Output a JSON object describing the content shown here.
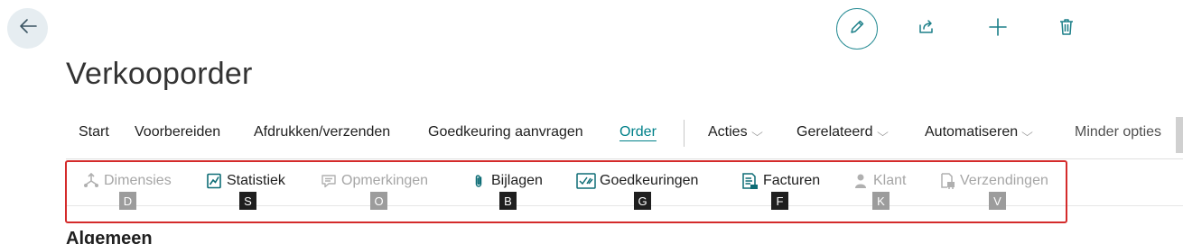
{
  "page": {
    "title": "Verkooporder"
  },
  "actions": {
    "back": "arrow-left-icon",
    "edit": "pencil-icon",
    "share": "share-icon",
    "add": "plus-icon",
    "delete": "trash-icon"
  },
  "menu": {
    "items": [
      {
        "label": "Start"
      },
      {
        "label": "Voorbereiden"
      },
      {
        "label": "Afdrukken/verzenden"
      },
      {
        "label": "Goedkeuring aanvragen"
      },
      {
        "label": "Order",
        "active": true
      },
      {
        "label": "Acties",
        "dropdown": true
      },
      {
        "label": "Gerelateerd",
        "dropdown": true
      },
      {
        "label": "Automatiseren",
        "dropdown": true
      },
      {
        "label": "Minder opties"
      }
    ]
  },
  "subactions": [
    {
      "label": "Dimensies",
      "key": "D",
      "enabled": false,
      "icon": "dimensions-icon"
    },
    {
      "label": "Statistiek",
      "key": "S",
      "enabled": true,
      "icon": "statistics-icon"
    },
    {
      "label": "Opmerkingen",
      "key": "O",
      "enabled": false,
      "icon": "comment-icon"
    },
    {
      "label": "Bijlagen",
      "key": "B",
      "enabled": true,
      "icon": "paperclip-icon"
    },
    {
      "label": "Goedkeuringen",
      "key": "G",
      "enabled": true,
      "icon": "approvals-icon"
    },
    {
      "label": "Facturen",
      "key": "F",
      "enabled": true,
      "icon": "invoice-icon"
    },
    {
      "label": "Klant",
      "key": "K",
      "enabled": false,
      "icon": "person-icon"
    },
    {
      "label": "Verzendingen",
      "key": "V",
      "enabled": false,
      "icon": "shipment-icon"
    }
  ],
  "section": {
    "title": "Algemeen"
  },
  "colors": {
    "accent": "#008089",
    "highlight": "#d42b2b",
    "disabled": "#a6a6a6",
    "key_bg": "#1f1f1f"
  }
}
